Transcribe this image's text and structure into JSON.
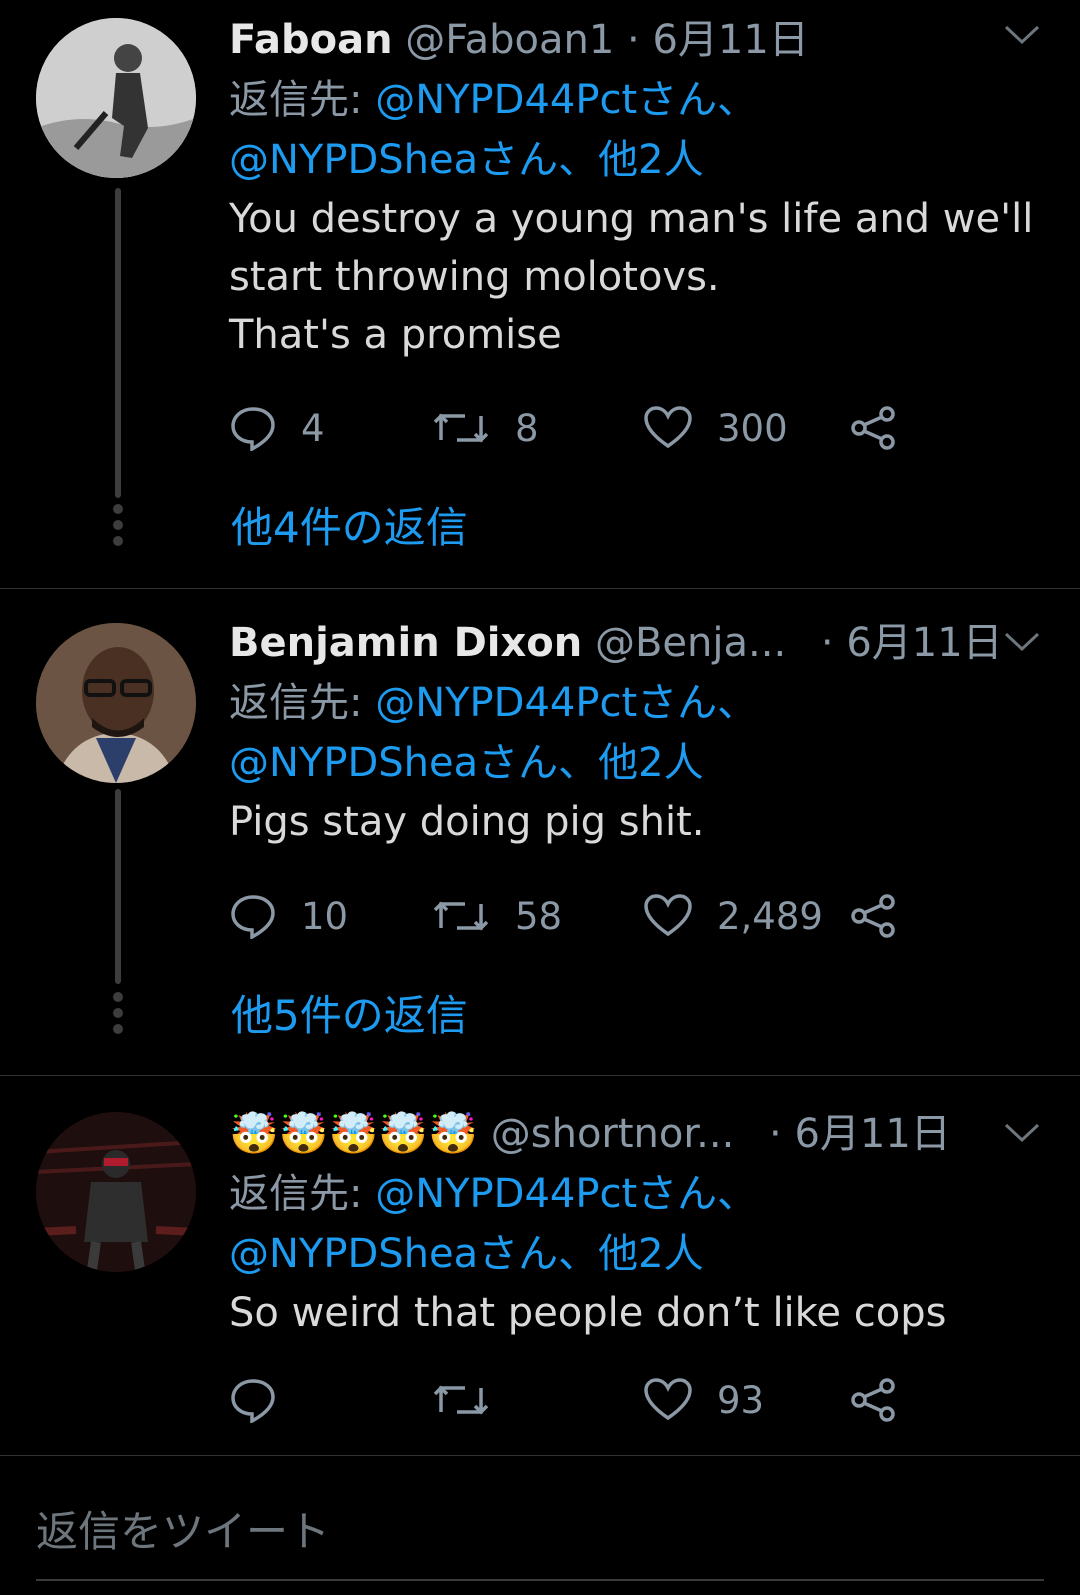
{
  "tweets": [
    {
      "name": "Faboan",
      "handle": "@Faboan1",
      "date": "6月11日",
      "reply_to_label": "返信先:",
      "reply_to_users": "@NYPD44Pctさん、",
      "reply_to_users_2": "@NYPDSheaさん、他2人",
      "text_lines": [
        "You destroy a young man's life and we'll",
        "start throwing molotovs.",
        "That's a promise"
      ],
      "replies": "4",
      "retweets": "8",
      "likes": "300",
      "more_replies": "他4件の返信"
    },
    {
      "name": "Benjamin Dixon",
      "handle": "@Benja...",
      "date": "6月11日",
      "reply_to_label": "返信先:",
      "reply_to_users": "@NYPD44Pctさん、",
      "reply_to_users_2": "@NYPDSheaさん、他2人",
      "text_lines": [
        "Pigs stay doing pig shit."
      ],
      "replies": "10",
      "retweets": "58",
      "likes": "2,489",
      "more_replies": "他5件の返信"
    },
    {
      "name": "🤯🤯🤯🤯🤯",
      "handle": "@shortnor...",
      "date": "6月11日",
      "reply_to_label": "返信先:",
      "reply_to_users": "@NYPD44Pctさん、",
      "reply_to_users_2": "@NYPDSheaさん、他2人",
      "text_lines": [
        "So weird that people don’t like cops"
      ],
      "replies": "",
      "retweets": "",
      "likes": "93"
    }
  ],
  "compose": {
    "placeholder": "返信をツイート"
  },
  "colors": {
    "accent": "#1d9bf0",
    "muted": "#8b98a5",
    "background": "#000000"
  },
  "icons": [
    "reply-icon",
    "retweet-icon",
    "like-icon",
    "share-icon",
    "chevron-down-icon",
    "thread-more-icon"
  ]
}
